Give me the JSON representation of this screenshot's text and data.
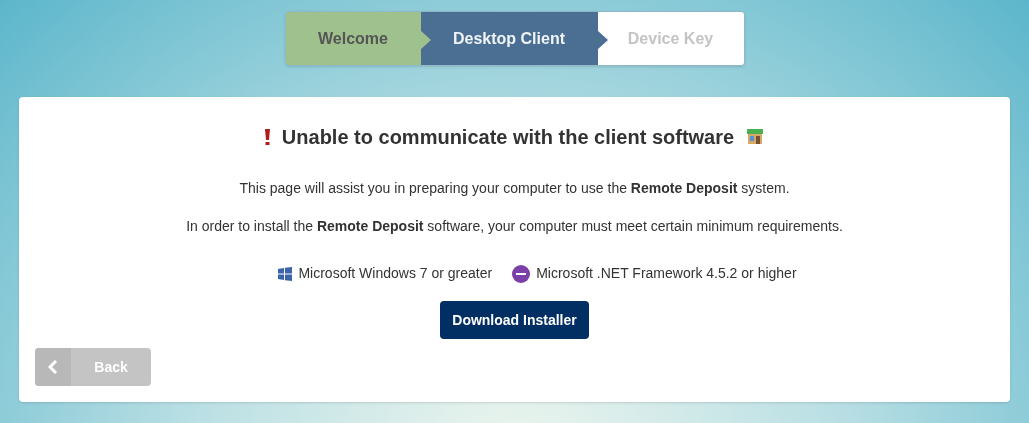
{
  "steps": [
    {
      "label": "Welcome",
      "completed": true,
      "selected": false
    },
    {
      "label": "Desktop Client",
      "completed": false,
      "selected": true
    },
    {
      "label": "Device Key",
      "completed": false,
      "selected": false
    }
  ],
  "heading": "Unable to communicate with the client software",
  "paragraphs": [
    "This page will assist you in preparing your computer to use the **Remote Deposit** system.",
    "In order to install the **Remote Deposit** software, your computer must meet certain minimum requirements."
  ],
  "requirements": [
    {
      "kind": "windows",
      "label": "Microsoft Windows 7 or greater"
    },
    {
      "kind": "dotnet",
      "label": "Microsoft .NET Framework 4.5.2 or higher"
    }
  ],
  "download_button": "Download Installer",
  "back_button": {
    "label": "Back",
    "disabled": true
  }
}
